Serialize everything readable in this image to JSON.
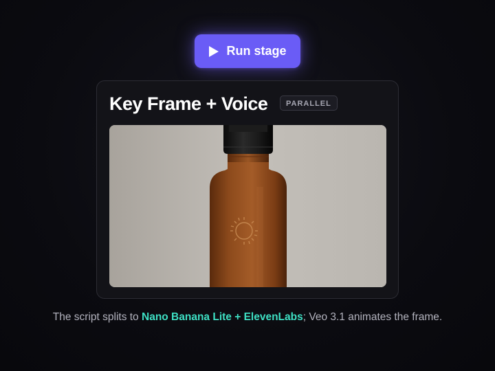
{
  "run_button": {
    "label": "Run stage",
    "icon": "play-icon",
    "color": "#6a5cf6"
  },
  "card": {
    "title": "Key Frame + Voice",
    "badge": "PARALLEL"
  },
  "key_frame": {
    "subject": "amber glass dropper bottle with embossed sun emblem on neutral grey background"
  },
  "caption": {
    "prefix": "The script splits to ",
    "highlight": "Nano Banana Lite + ElevenLabs",
    "suffix": "; Veo 3.1 animates the frame.",
    "highlight_color": "#3ee0c4"
  }
}
